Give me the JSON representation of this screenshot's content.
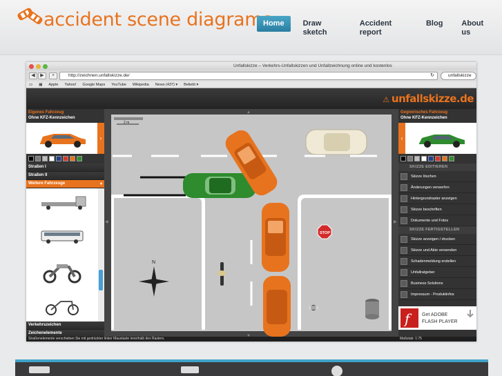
{
  "site": {
    "logo_text": "accident scene diagrams",
    "nav": [
      {
        "label": "Home",
        "active": true
      },
      {
        "label": "Draw sketch",
        "active": false
      },
      {
        "label": "Accident report",
        "active": false
      },
      {
        "label": "Blog",
        "active": false
      },
      {
        "label": "About us",
        "active": false
      }
    ]
  },
  "browser": {
    "window_title": "Unfallskizze – Verkehrs-Unfallskizzen und Unfallzeichnung online und kostenlos",
    "url": "http://zeichnen.unfallskizze.de/",
    "search_text": "unfallskizze",
    "bookmarks": [
      "Apple",
      "Yahoo!",
      "Google Maps",
      "YouTube",
      "Wikipedia",
      "News (437) ▾",
      "Beliebt ▾"
    ]
  },
  "app": {
    "logo": "unfallskizze.de",
    "left": {
      "title": "Eigenes Fahrzeug",
      "subtitle": "Ohne KFZ-Kennzeichen",
      "items": [
        "Straßen I",
        "Straßen II",
        "Weitere Fahrzeuge"
      ],
      "bottom_items": [
        "Verkehrszeichen",
        "Zeichenelemente"
      ]
    },
    "right": {
      "title": "Gegnerisches Fahrzeug",
      "subtitle": "Ohne KFZ-Kennzeichen",
      "section1": "SKIZZE EDITIEREN",
      "edit_items": [
        "Skizze löschen",
        "Änderungen verwerfen",
        "Hintergrundraster anzeigen",
        "Skizze beschriften",
        "Dokumente und Fotos"
      ],
      "section2": "SKIZZE FERTIGSTELLEN",
      "finish_items": [
        "Skizze anzeigen / drucken",
        "Skizze und Akte versenden",
        "Schadenmeldung erstellen",
        "Unfallratgeber",
        "Business Solutions",
        "Impressum - Produktinfos"
      ]
    },
    "canvas": {
      "scale_label": "2 m",
      "compass_n": "N",
      "stop_text": "STOP"
    },
    "flash": {
      "line1": "Get ADOBE",
      "line2": "FLASH PLAYER"
    },
    "status": "Straßenelemente verschieben Sie mit gedrückter linker Maustaste innerhalb des Rasters.",
    "scale_status": "Maßstab: 1:75"
  },
  "colors": {
    "accent": "#e8731e",
    "nav_active": "#3a93b6",
    "swatches": [
      "#000000",
      "#7a7a7a",
      "#bdbdbd",
      "#ffffff",
      "#1f3f8f",
      "#d33a2c",
      "#e8731e",
      "#2f8f2f",
      "#0a0a0a",
      "#4b2a14",
      "#ffffff"
    ]
  }
}
